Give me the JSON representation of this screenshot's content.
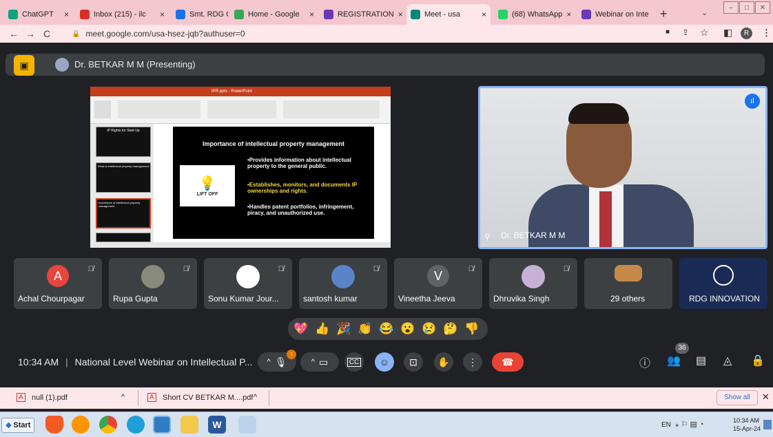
{
  "browser": {
    "tabs": [
      {
        "label": "ChatGPT",
        "icon": "chatgpt-icon",
        "color": "#10a37f"
      },
      {
        "label": "Inbox (215) - ilc",
        "icon": "gmail-icon",
        "color": "#d93025"
      },
      {
        "label": "Smt. RDG Colle",
        "icon": "college-icon",
        "color": "#1a73e8"
      },
      {
        "label": "Home - Google",
        "icon": "drive-icon",
        "color": "#34a853"
      },
      {
        "label": "REGISTRATION",
        "icon": "forms-icon",
        "color": "#673ab7"
      },
      {
        "label": "Meet - usa",
        "icon": "meet-icon",
        "color": "#00897b"
      },
      {
        "label": "(68) WhatsApp",
        "icon": "whatsapp-icon",
        "color": "#25d366"
      },
      {
        "label": "Webinar on Inte",
        "icon": "forms-icon",
        "color": "#673ab7"
      }
    ],
    "url": "meet.google.com/usa-hsez-jqb?authuser=0",
    "profile_initial": "R"
  },
  "meet": {
    "presenter_label": "Dr. BETKAR M M (Presenting)",
    "speaker_name": "Dr. BETKAR M M",
    "time": "10:34 AM",
    "meeting_title": "National Level Webinar on Intellectual P...",
    "participant_count": "36",
    "participants": [
      {
        "name": "Achal Chourpagar",
        "avatar": "A",
        "color": "#e8453c"
      },
      {
        "name": "Rupa Gupta",
        "avatar": "",
        "color": "#8a8a7a"
      },
      {
        "name": "Sonu Kumar Jour...",
        "avatar": "",
        "color": "#ffffff"
      },
      {
        "name": "santosh kumar",
        "avatar": "",
        "color": "#5a84c8"
      },
      {
        "name": "Vineetha Jeeva",
        "avatar": "V",
        "color": "#5f6368"
      },
      {
        "name": "Dhruvika Singh",
        "avatar": "",
        "color": "#c7b2d6"
      },
      {
        "name": "29 others",
        "avatar": "",
        "color": "#c7894a"
      },
      {
        "name": "RDG INNOVATION",
        "avatar": "",
        "color": "#1f3a6e"
      }
    ],
    "reactions": [
      "💖",
      "👍",
      "🎉",
      "👏",
      "😂",
      "😮",
      "😢",
      "🤔",
      "👎"
    ]
  },
  "slide": {
    "title": "Importance of intellectual property management",
    "bullets": [
      "•Provides information about intellectual property to the general public.",
      "•Establishes, monitors, and documents IP ownerships and rights.",
      "•Handles patent portfolios, infringement, piracy, and unauthorized use."
    ],
    "logo_text": "LIFT OFF",
    "thumb_titles": [
      "IP Rights for Start-Up",
      "What is Intellectual property management",
      "Importance of intellectual property management"
    ],
    "app_title": "IPR.pptx - PowerPoint"
  },
  "downloads": {
    "files": [
      "null (1).pdf",
      "Short CV BETKAR M....pdf"
    ],
    "show_all": "Show all"
  },
  "taskbar": {
    "start": "Start",
    "lang": "EN",
    "time": "10:34 AM",
    "date": "15-Apr-24"
  }
}
